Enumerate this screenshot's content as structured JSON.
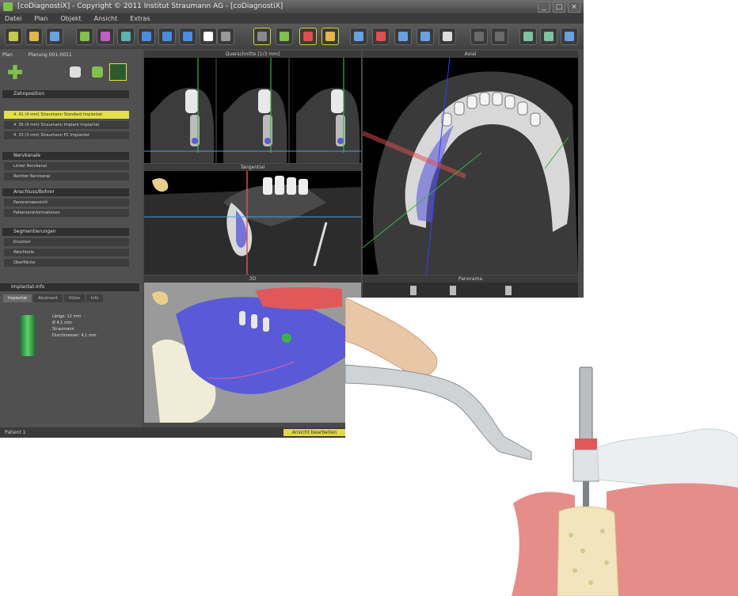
{
  "window": {
    "title": "[coDiagnostiX] - Copyright © 2011 Institut Straumann AG - [coDiagnostiX]",
    "controls": [
      "_",
      "□",
      "×"
    ]
  },
  "menu": [
    "Datei",
    "Plan",
    "Objekt",
    "Ansicht",
    "Extras"
  ],
  "left_panel": {
    "plan_label": "Plan",
    "plan_value": "Planung 001-0011",
    "sections": [
      {
        "title": "Zahnposition",
        "rows": [
          "4. 41   (4 mm)   Straumann Standard Implantat",
          "4. 36   (4 mm)   Straumann Implant Implantat",
          "4. 33   (3 mm)   Straumann PC Implantat"
        ]
      },
      {
        "title": "Nervkanale",
        "rows": [
          "Linker Nervkanal",
          "Rechter Nervkanal"
        ]
      },
      {
        "title": "Anschluss/Bohrer",
        "rows": [
          "Panoramaansicht",
          "Patienteninformationen"
        ]
      },
      {
        "title": "Segmentierungen",
        "rows": [
          "Knochen",
          "Weichteile",
          "Oberfläche"
        ]
      }
    ],
    "detail_title": "Implantat-Info",
    "detail_tabs": [
      "Implantat",
      "Abutment",
      "Hülse",
      "Info"
    ],
    "implant_info": [
      "Länge: 12 mm",
      "Ø 4,1 mm",
      "Straumann",
      "Durchmesser: 4,1 mm"
    ]
  },
  "viewports": {
    "crosssection": "Querschnitte  [1/3 mm]",
    "axial": "Axial",
    "tangential": "Tangential",
    "three_d": "3D",
    "panorama": "Panorama"
  },
  "status": {
    "patient": "Patient 1",
    "badge": "Ansicht bearbeiten"
  },
  "colors": {
    "accent_yellow": "#e3e04a",
    "implant_green": "#3bb34a",
    "mandible_blue": "#5a5ad8",
    "gingiva_red": "#e0585a"
  }
}
